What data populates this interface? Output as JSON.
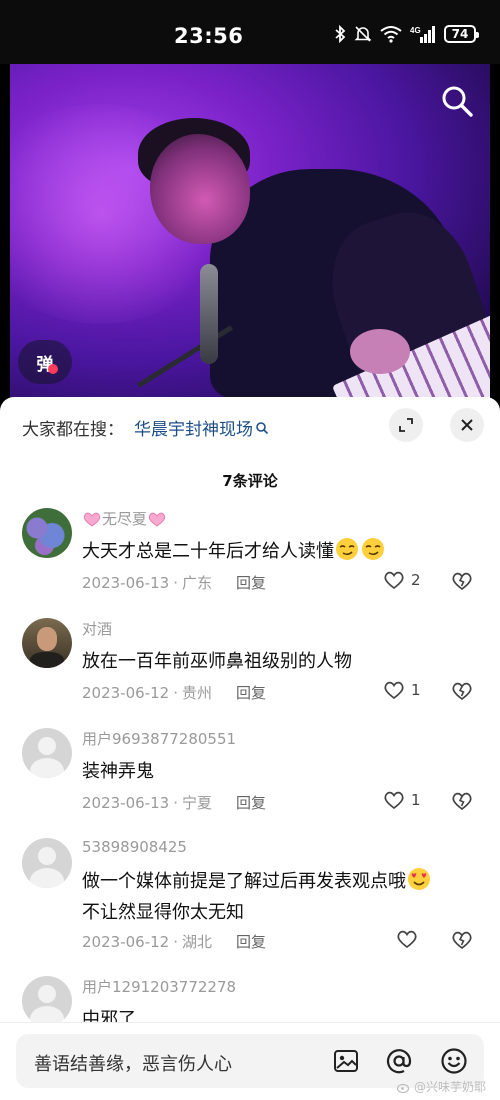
{
  "status_bar": {
    "time": "23:56",
    "network": "4G",
    "battery": "74"
  },
  "video": {
    "danmu_label": "弹"
  },
  "hot_search": {
    "label": "大家都在搜：",
    "term": "华晨宇封神现场"
  },
  "comments_header": {
    "count_label": "7条评论"
  },
  "comments": [
    {
      "username": "无尽夏",
      "text": "大天才总是二十年后才给人读懂",
      "date": "2023-06-13",
      "location": "广东",
      "reply": "回复",
      "likes": "2"
    },
    {
      "username": "对酒",
      "text": "放在一百年前巫师鼻祖级别的人物",
      "date": "2023-06-12",
      "location": "贵州",
      "reply": "回复",
      "likes": "1"
    },
    {
      "username": "用户9693877280551",
      "text": "装神弄鬼",
      "date": "2023-06-13",
      "location": "宁夏",
      "reply": "回复",
      "likes": "1"
    },
    {
      "username": "53898908425",
      "text_line1": "做一个媒体前提是了解过后再发表观点哦",
      "text_line2": "不让然显得你太无知",
      "date": "2023-06-12",
      "location": "湖北",
      "reply": "回复",
      "likes": ""
    },
    {
      "username": "用户1291203772278",
      "text": "中邪了"
    }
  ],
  "input_bar": {
    "placeholder": "善语结善缘，恶言伤人心"
  },
  "watermark": {
    "text": "@兴味芋奶耶"
  },
  "icons": [
    "bluetooth-icon",
    "mute-icon",
    "wifi-icon",
    "signal-icon",
    "search-icon",
    "expand-icon",
    "close-icon",
    "heart-icon",
    "broken-heart-icon",
    "image-icon",
    "at-icon",
    "emoji-icon"
  ]
}
